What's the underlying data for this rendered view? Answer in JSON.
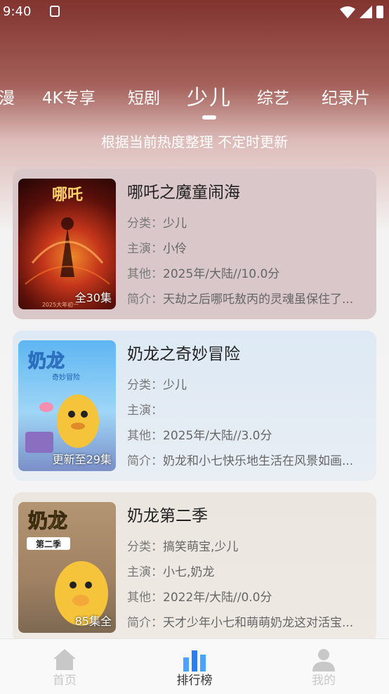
{
  "status": {
    "time": "9:40"
  },
  "tabs": [
    {
      "label": "漫",
      "active": false
    },
    {
      "label": "4K专享",
      "active": false
    },
    {
      "label": "短剧",
      "active": false
    },
    {
      "label": "少儿",
      "active": true
    },
    {
      "label": "综艺",
      "active": false
    },
    {
      "label": "纪录片",
      "active": false
    }
  ],
  "subtitle": "根据当前热度整理 不定时更新",
  "cards": [
    {
      "title": "哪吒之魔童闹海",
      "badge": "全30集",
      "category_label": "分类：",
      "category": "少儿",
      "cast_label": "主演：",
      "cast": "小伶",
      "other_label": "其他：",
      "other": "2025年/大陆//10.0分",
      "intro_label": "简介：",
      "intro": "天劫之后哪吒敖丙的灵魂虽保住了..."
    },
    {
      "title": "奶龙之奇妙冒险",
      "badge": "更新至29集",
      "category_label": "分类：",
      "category": "少儿",
      "cast_label": "主演：",
      "cast": "",
      "other_label": "其他：",
      "other": "2025年/大陆//3.0分",
      "intro_label": "简介：",
      "intro": "奶龙和小七快乐地生活在风景如画..."
    },
    {
      "title": "奶龙第二季",
      "badge": "85集全",
      "category_label": "分类：",
      "category": "搞笑萌宝,少儿",
      "cast_label": "主演：",
      "cast": "小七,奶龙",
      "other_label": "其他：",
      "other": "2022年/大陆//0.0分",
      "intro_label": "简介：",
      "intro": "天才少年小七和萌萌奶龙这对活宝..."
    }
  ],
  "posters": [
    {
      "logo_text": "哪吒",
      "caption": "2025大年初一"
    },
    {
      "logo_text": "奶龙",
      "sub_text": "奇妙冒险"
    },
    {
      "logo_text": "奶龙",
      "sub_text": "第二季"
    }
  ],
  "nav": [
    {
      "label": "首页",
      "icon": "home-icon",
      "active": false
    },
    {
      "label": "排行榜",
      "icon": "ranking-icon",
      "active": true
    },
    {
      "label": "我的",
      "icon": "profile-icon",
      "active": false
    }
  ],
  "colors": {
    "accent": "#2f7df6",
    "header_top": "#7a231e"
  }
}
